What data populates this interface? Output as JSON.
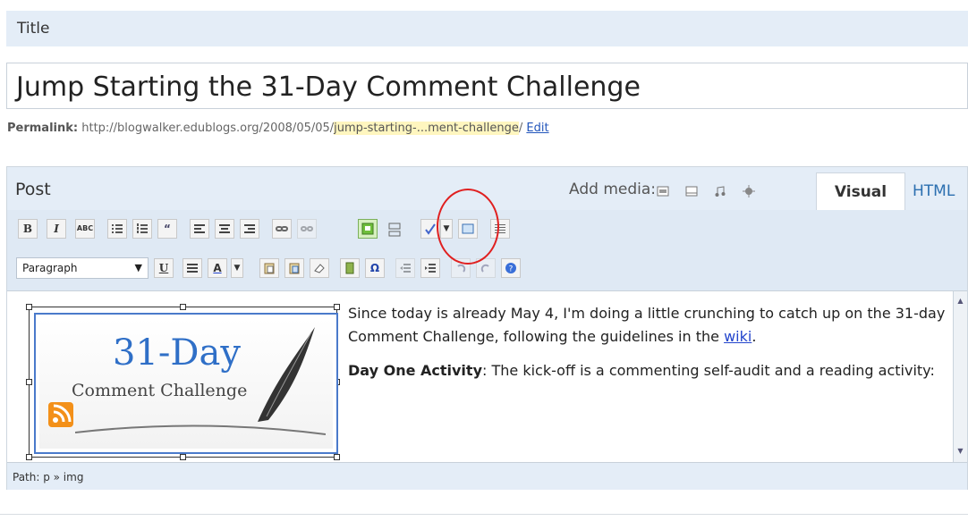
{
  "title_section": {
    "label": "Title",
    "value": "Jump Starting the 31-Day Comment Challenge"
  },
  "permalink": {
    "label": "Permalink:",
    "url_prefix": "http://blogwalker.edublogs.org/2008/05/05/",
    "slug": "jump-starting-...ment-challenge",
    "suffix": "/",
    "edit_label": "Edit"
  },
  "post": {
    "label": "Post",
    "add_media_label": "Add media:",
    "media_icons": [
      "image-icon",
      "video-icon",
      "audio-icon",
      "media-icon"
    ],
    "tabs": {
      "visual": "Visual",
      "html": "HTML"
    },
    "toolbar": {
      "bold": "B",
      "italic": "I",
      "strike": "ABC",
      "underline": "U",
      "format_selected": "Paragraph",
      "font_color": "A",
      "omega": "Ω"
    },
    "content": {
      "p1_before_link": "Since today is already May 4, I'm doing a little crunching to catch up on the 31-day Comment Challenge, following the guidelines in the ",
      "p1_link": "wiki",
      "p1_after": ".",
      "p2_bold": "Day One Activity",
      "p2_rest": ": The kick-off is a commenting self-audit and a reading activity:"
    },
    "image": {
      "title_line": "31-Day",
      "subtitle_line": "Comment Challenge"
    },
    "path_label": "Path: p » img"
  },
  "colors": {
    "accent_blue": "#2b6fb0",
    "highlight_red": "#e02020",
    "slug_highlight": "#fff6bf"
  }
}
